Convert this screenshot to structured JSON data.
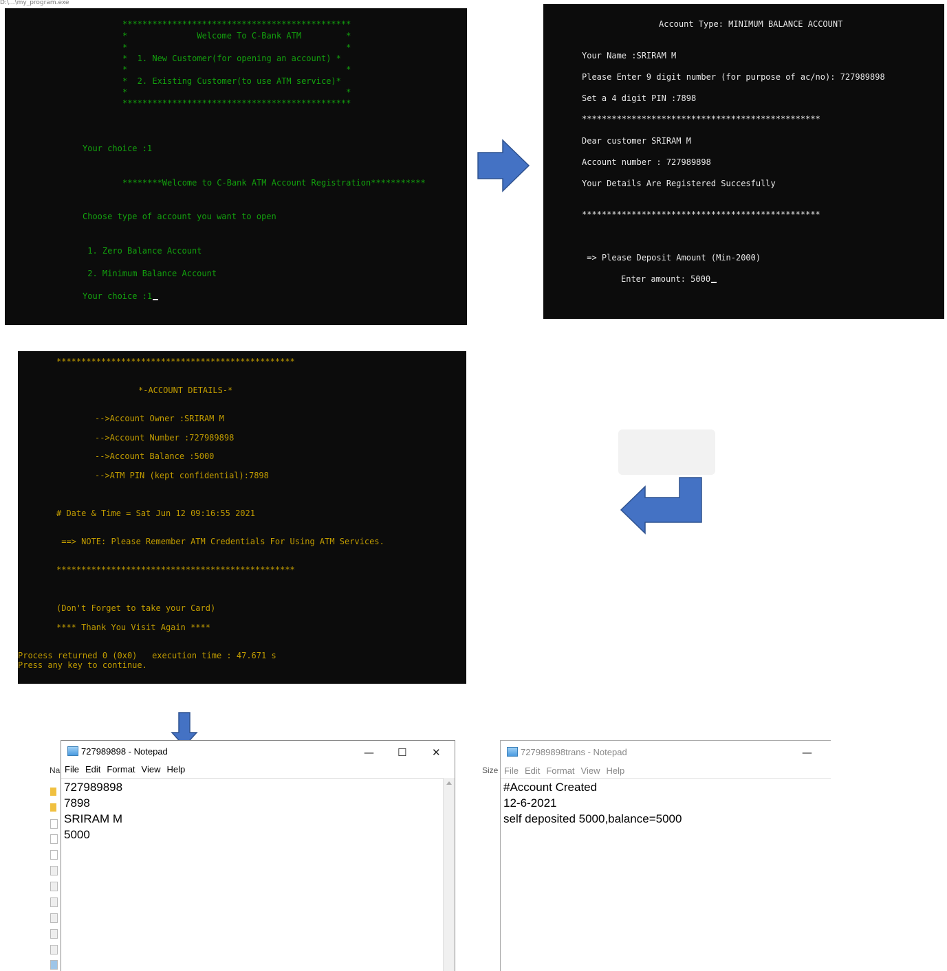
{
  "top_strip_text": "D:\\...\\my_program.exe",
  "console1": {
    "lines": [
      "**********************************************",
      "*              Welcome To C-Bank ATM         *",
      "*                                            *",
      "*  1. New Customer(for opening an account) *",
      "*                                            *",
      "*  2. Existing Customer(to use ATM service)*",
      "*                                            *",
      "**********************************************",
      "Your choice :1",
      "********Welcome to C-Bank ATM Account Registration***********",
      "Choose type of account you want to open",
      " 1. Zero Balance Account",
      " 2. Minimum Balance Account",
      "Your choice :1"
    ]
  },
  "console2": {
    "lines": [
      "Account Type: MINIMUM BALANCE ACCOUNT",
      "Your Name :SRIRAM M",
      "Please Enter 9 digit number (for purpose of ac/no): 727989898",
      "Set a 4 digit PIN :7898",
      "************************************************",
      "Dear customer SRIRAM M",
      "Account number : 727989898",
      "Your Details Are Registered Succesfully",
      "************************************************",
      " => Please Deposit Amount (Min-2000)",
      "Enter amount: 5000"
    ]
  },
  "console3": {
    "lines": [
      "************************************************",
      "*-ACCOUNT DETAILS-*",
      "-->Account Owner :SRIRAM M",
      "-->Account Number :727989898",
      "-->Account Balance :5000",
      "-->ATM PIN (kept confidential):7898",
      "# Date & Time = Sat Jun 12 09:16:55 2021",
      " ==> NOTE: Please Remember ATM Credentials For Using ATM Services.",
      "************************************************",
      "(Don't Forget to take your Card)",
      "**** Thank You Visit Again ****",
      "Process returned 0 (0x0)   execution time : 47.671 s",
      "Press any key to continue."
    ]
  },
  "notepad1": {
    "title": "727989898 - Notepad",
    "menu": [
      "File",
      "Edit",
      "Format",
      "View",
      "Help"
    ],
    "lines": [
      "727989898",
      "7898",
      "SRIRAM M",
      "5000"
    ],
    "minimize": "—",
    "maximize": "☐",
    "close": "✕"
  },
  "notepad2": {
    "title": "727989898trans - Notepad",
    "menu": [
      "File",
      "Edit",
      "Format",
      "View",
      "Help"
    ],
    "lines": [
      "#Account Created",
      "12-6-2021",
      "self deposited 5000,balance=5000"
    ],
    "minimize": "—"
  },
  "explorer_fragments": {
    "name_col": "Nar",
    "size_col": "Size"
  },
  "colors": {
    "arrow": "#4472c4",
    "console_bg": "#0c0c0c",
    "green_text": "#13a10e",
    "amber_text": "#c19c00"
  }
}
